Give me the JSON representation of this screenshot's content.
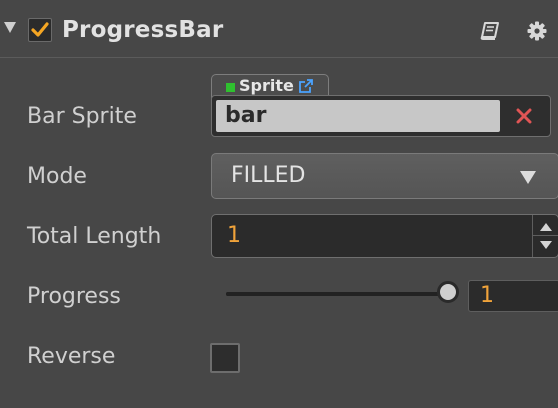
{
  "component": {
    "title": "ProgressBar",
    "enabled": true,
    "accent_color": "#f5a623"
  },
  "properties": {
    "bar_sprite": {
      "label": "Bar Sprite",
      "asset_type": "Sprite",
      "value": "bar",
      "clear_color": "#e05555",
      "asset_type_color": "#2fc02f"
    },
    "mode": {
      "label": "Mode",
      "value": "FILLED"
    },
    "total_length": {
      "label": "Total Length",
      "value": "1"
    },
    "progress": {
      "label": "Progress",
      "value": "1",
      "fraction": 1.0
    },
    "reverse": {
      "label": "Reverse",
      "checked": false
    }
  },
  "icons": {
    "collapse": "triangle-down-icon",
    "check": "checkmark-icon",
    "help": "book-icon",
    "settings": "gear-icon",
    "asset_link": "external-link-icon",
    "clear": "close-icon"
  }
}
